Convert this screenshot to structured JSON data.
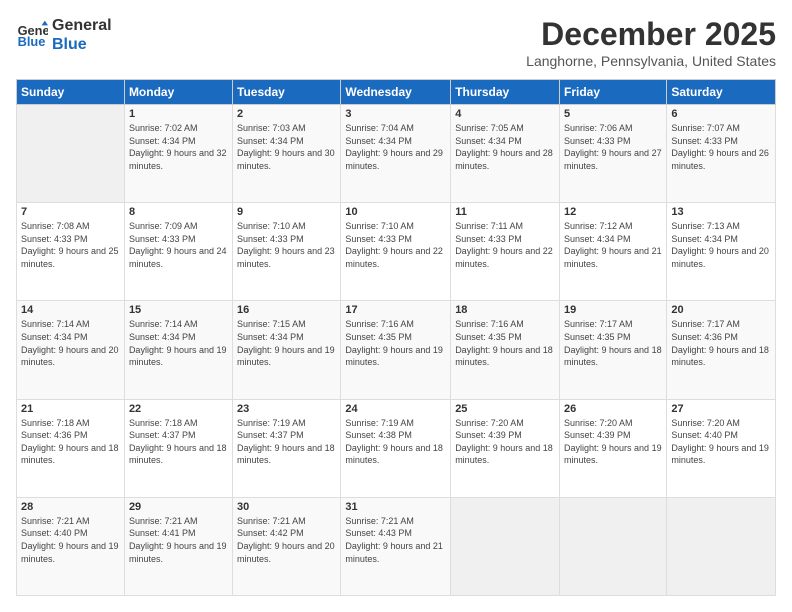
{
  "logo": {
    "line1": "General",
    "line2": "Blue"
  },
  "title": "December 2025",
  "location": "Langhorne, Pennsylvania, United States",
  "days_header": [
    "Sunday",
    "Monday",
    "Tuesday",
    "Wednesday",
    "Thursday",
    "Friday",
    "Saturday"
  ],
  "weeks": [
    [
      {
        "num": "",
        "sunrise": "",
        "sunset": "",
        "daylight": "",
        "empty": true
      },
      {
        "num": "1",
        "sunrise": "Sunrise: 7:02 AM",
        "sunset": "Sunset: 4:34 PM",
        "daylight": "Daylight: 9 hours and 32 minutes."
      },
      {
        "num": "2",
        "sunrise": "Sunrise: 7:03 AM",
        "sunset": "Sunset: 4:34 PM",
        "daylight": "Daylight: 9 hours and 30 minutes."
      },
      {
        "num": "3",
        "sunrise": "Sunrise: 7:04 AM",
        "sunset": "Sunset: 4:34 PM",
        "daylight": "Daylight: 9 hours and 29 minutes."
      },
      {
        "num": "4",
        "sunrise": "Sunrise: 7:05 AM",
        "sunset": "Sunset: 4:34 PM",
        "daylight": "Daylight: 9 hours and 28 minutes."
      },
      {
        "num": "5",
        "sunrise": "Sunrise: 7:06 AM",
        "sunset": "Sunset: 4:33 PM",
        "daylight": "Daylight: 9 hours and 27 minutes."
      },
      {
        "num": "6",
        "sunrise": "Sunrise: 7:07 AM",
        "sunset": "Sunset: 4:33 PM",
        "daylight": "Daylight: 9 hours and 26 minutes."
      }
    ],
    [
      {
        "num": "7",
        "sunrise": "Sunrise: 7:08 AM",
        "sunset": "Sunset: 4:33 PM",
        "daylight": "Daylight: 9 hours and 25 minutes."
      },
      {
        "num": "8",
        "sunrise": "Sunrise: 7:09 AM",
        "sunset": "Sunset: 4:33 PM",
        "daylight": "Daylight: 9 hours and 24 minutes."
      },
      {
        "num": "9",
        "sunrise": "Sunrise: 7:10 AM",
        "sunset": "Sunset: 4:33 PM",
        "daylight": "Daylight: 9 hours and 23 minutes."
      },
      {
        "num": "10",
        "sunrise": "Sunrise: 7:10 AM",
        "sunset": "Sunset: 4:33 PM",
        "daylight": "Daylight: 9 hours and 22 minutes."
      },
      {
        "num": "11",
        "sunrise": "Sunrise: 7:11 AM",
        "sunset": "Sunset: 4:33 PM",
        "daylight": "Daylight: 9 hours and 22 minutes."
      },
      {
        "num": "12",
        "sunrise": "Sunrise: 7:12 AM",
        "sunset": "Sunset: 4:34 PM",
        "daylight": "Daylight: 9 hours and 21 minutes."
      },
      {
        "num": "13",
        "sunrise": "Sunrise: 7:13 AM",
        "sunset": "Sunset: 4:34 PM",
        "daylight": "Daylight: 9 hours and 20 minutes."
      }
    ],
    [
      {
        "num": "14",
        "sunrise": "Sunrise: 7:14 AM",
        "sunset": "Sunset: 4:34 PM",
        "daylight": "Daylight: 9 hours and 20 minutes."
      },
      {
        "num": "15",
        "sunrise": "Sunrise: 7:14 AM",
        "sunset": "Sunset: 4:34 PM",
        "daylight": "Daylight: 9 hours and 19 minutes."
      },
      {
        "num": "16",
        "sunrise": "Sunrise: 7:15 AM",
        "sunset": "Sunset: 4:34 PM",
        "daylight": "Daylight: 9 hours and 19 minutes."
      },
      {
        "num": "17",
        "sunrise": "Sunrise: 7:16 AM",
        "sunset": "Sunset: 4:35 PM",
        "daylight": "Daylight: 9 hours and 19 minutes."
      },
      {
        "num": "18",
        "sunrise": "Sunrise: 7:16 AM",
        "sunset": "Sunset: 4:35 PM",
        "daylight": "Daylight: 9 hours and 18 minutes."
      },
      {
        "num": "19",
        "sunrise": "Sunrise: 7:17 AM",
        "sunset": "Sunset: 4:35 PM",
        "daylight": "Daylight: 9 hours and 18 minutes."
      },
      {
        "num": "20",
        "sunrise": "Sunrise: 7:17 AM",
        "sunset": "Sunset: 4:36 PM",
        "daylight": "Daylight: 9 hours and 18 minutes."
      }
    ],
    [
      {
        "num": "21",
        "sunrise": "Sunrise: 7:18 AM",
        "sunset": "Sunset: 4:36 PM",
        "daylight": "Daylight: 9 hours and 18 minutes."
      },
      {
        "num": "22",
        "sunrise": "Sunrise: 7:18 AM",
        "sunset": "Sunset: 4:37 PM",
        "daylight": "Daylight: 9 hours and 18 minutes."
      },
      {
        "num": "23",
        "sunrise": "Sunrise: 7:19 AM",
        "sunset": "Sunset: 4:37 PM",
        "daylight": "Daylight: 9 hours and 18 minutes."
      },
      {
        "num": "24",
        "sunrise": "Sunrise: 7:19 AM",
        "sunset": "Sunset: 4:38 PM",
        "daylight": "Daylight: 9 hours and 18 minutes."
      },
      {
        "num": "25",
        "sunrise": "Sunrise: 7:20 AM",
        "sunset": "Sunset: 4:39 PM",
        "daylight": "Daylight: 9 hours and 18 minutes."
      },
      {
        "num": "26",
        "sunrise": "Sunrise: 7:20 AM",
        "sunset": "Sunset: 4:39 PM",
        "daylight": "Daylight: 9 hours and 19 minutes."
      },
      {
        "num": "27",
        "sunrise": "Sunrise: 7:20 AM",
        "sunset": "Sunset: 4:40 PM",
        "daylight": "Daylight: 9 hours and 19 minutes."
      }
    ],
    [
      {
        "num": "28",
        "sunrise": "Sunrise: 7:21 AM",
        "sunset": "Sunset: 4:40 PM",
        "daylight": "Daylight: 9 hours and 19 minutes."
      },
      {
        "num": "29",
        "sunrise": "Sunrise: 7:21 AM",
        "sunset": "Sunset: 4:41 PM",
        "daylight": "Daylight: 9 hours and 19 minutes."
      },
      {
        "num": "30",
        "sunrise": "Sunrise: 7:21 AM",
        "sunset": "Sunset: 4:42 PM",
        "daylight": "Daylight: 9 hours and 20 minutes."
      },
      {
        "num": "31",
        "sunrise": "Sunrise: 7:21 AM",
        "sunset": "Sunset: 4:43 PM",
        "daylight": "Daylight: 9 hours and 21 minutes."
      },
      {
        "num": "",
        "sunrise": "",
        "sunset": "",
        "daylight": "",
        "empty": true
      },
      {
        "num": "",
        "sunrise": "",
        "sunset": "",
        "daylight": "",
        "empty": true
      },
      {
        "num": "",
        "sunrise": "",
        "sunset": "",
        "daylight": "",
        "empty": true
      }
    ]
  ]
}
